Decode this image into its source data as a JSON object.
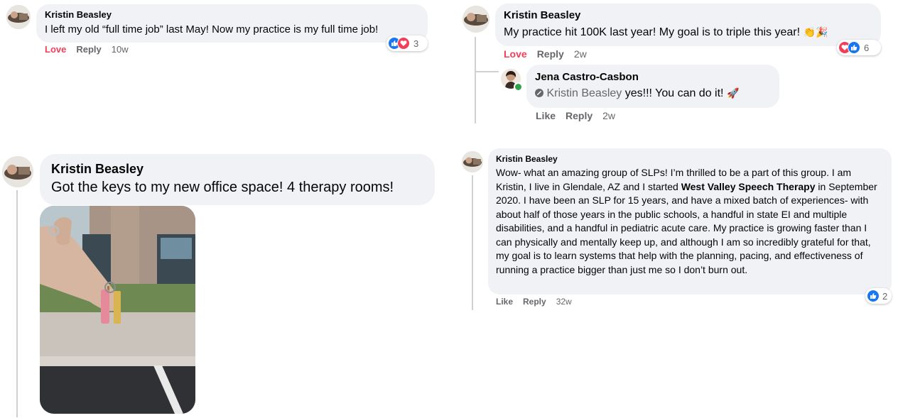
{
  "colors": {
    "bubble": "#f0f2f5",
    "love": "#f33e58",
    "like": "#1877f2",
    "muted": "#65676b"
  },
  "c1": {
    "name": "Kristin Beasley",
    "text": "I left my old “full time job” last May! Now my practice is my full time job!",
    "action1": "Love",
    "action2": "Reply",
    "time": "10w",
    "reactions": {
      "icons": [
        "like-icon",
        "love-icon"
      ],
      "count": "3"
    }
  },
  "c2": {
    "name": "Kristin Beasley",
    "text": "My practice hit 100K last year! My goal is to triple this year!",
    "emoji": "👏🎉",
    "action1": "Love",
    "action2": "Reply",
    "time": "2w",
    "reactions": {
      "icons": [
        "love-icon",
        "like-icon"
      ],
      "count": "6"
    },
    "reply": {
      "name": "Jena Castro-Casbon",
      "mention": "Kristin Beasley",
      "text": " yes!!! You can do it!",
      "emoji": "🚀",
      "action1": "Like",
      "action2": "Reply",
      "time": "2w"
    }
  },
  "c3": {
    "name": "Kristin Beasley",
    "text": "Got the keys to my new office space! 4 therapy rooms!"
  },
  "c4": {
    "name": "Kristin Beasley",
    "text_a": "Wow- what an amazing group of SLPs! I’m thrilled to be a part of this group. I am Kristin, I live in Glendale, AZ and I started ",
    "bold": "West Valley Speech Therapy",
    "text_b": " in September 2020. I have been an SLP for 15 years, and have a mixed batch of experiences- with about half of those years in the public schools, a handful in state EI and multiple disabilities, and a handful in pediatric acute care. My practice is growing faster than I can physically and mentally keep up, and although I am so incredibly grateful for that, my goal is to learn systems that help with the planning, pacing, and effectiveness of running a practice bigger than just me so I don’t burn out.",
    "action1": "Like",
    "action2": "Reply",
    "time": "32w",
    "reactions": {
      "icons": [
        "like-icon"
      ],
      "count": "2"
    }
  }
}
